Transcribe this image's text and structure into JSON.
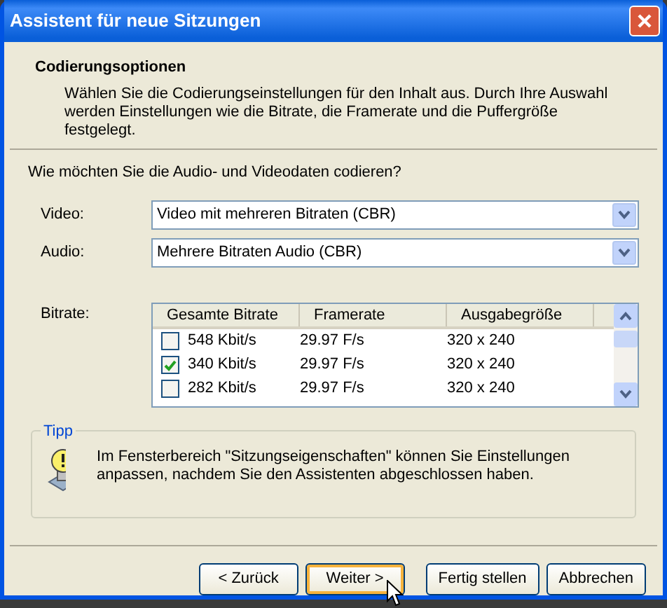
{
  "window": {
    "title": "Assistent für neue Sitzungen"
  },
  "header": {
    "title": "Codierungsoptionen",
    "description": "Wählen Sie die Codierungseinstellungen für den Inhalt aus. Durch Ihre Auswahl werden Einstellungen wie die Bitrate, die Framerate und die Puffergröße festgelegt."
  },
  "question": "Wie möchten Sie die Audio- und Videodaten codieren?",
  "selects": [
    {
      "label": "Video:",
      "value": "Video mit mehreren Bitraten (CBR)"
    },
    {
      "label": "Audio:",
      "value": "Mehrere Bitraten Audio (CBR)"
    }
  ],
  "bitrate": {
    "label": "Bitrate:",
    "columns": [
      "Gesamte Bitrate",
      "Framerate",
      "Ausgabegröße"
    ],
    "rows": [
      {
        "bitrate": "548 Kbit/s",
        "framerate": "29.97 F/s",
        "size": "320 x 240",
        "checked": false
      },
      {
        "bitrate": "340 Kbit/s",
        "framerate": "29.97 F/s",
        "size": "320 x 240",
        "checked": true
      },
      {
        "bitrate": "282 Kbit/s",
        "framerate": "29.97 F/s",
        "size": "320 x 240",
        "checked": false
      }
    ]
  },
  "tip": {
    "title": "Tipp",
    "text": "Im Fensterbereich \"Sitzungseigenschaften\" können Sie Einstellungen anpassen, nachdem Sie den Assistenten abgeschlossen haben."
  },
  "buttons": [
    {
      "label": "< Zurück",
      "focused": false
    },
    {
      "label": "Weiter >",
      "focused": true
    },
    {
      "label": "Fertig stellen",
      "focused": false
    },
    {
      "label": "Abbrechen",
      "focused": false
    }
  ]
}
